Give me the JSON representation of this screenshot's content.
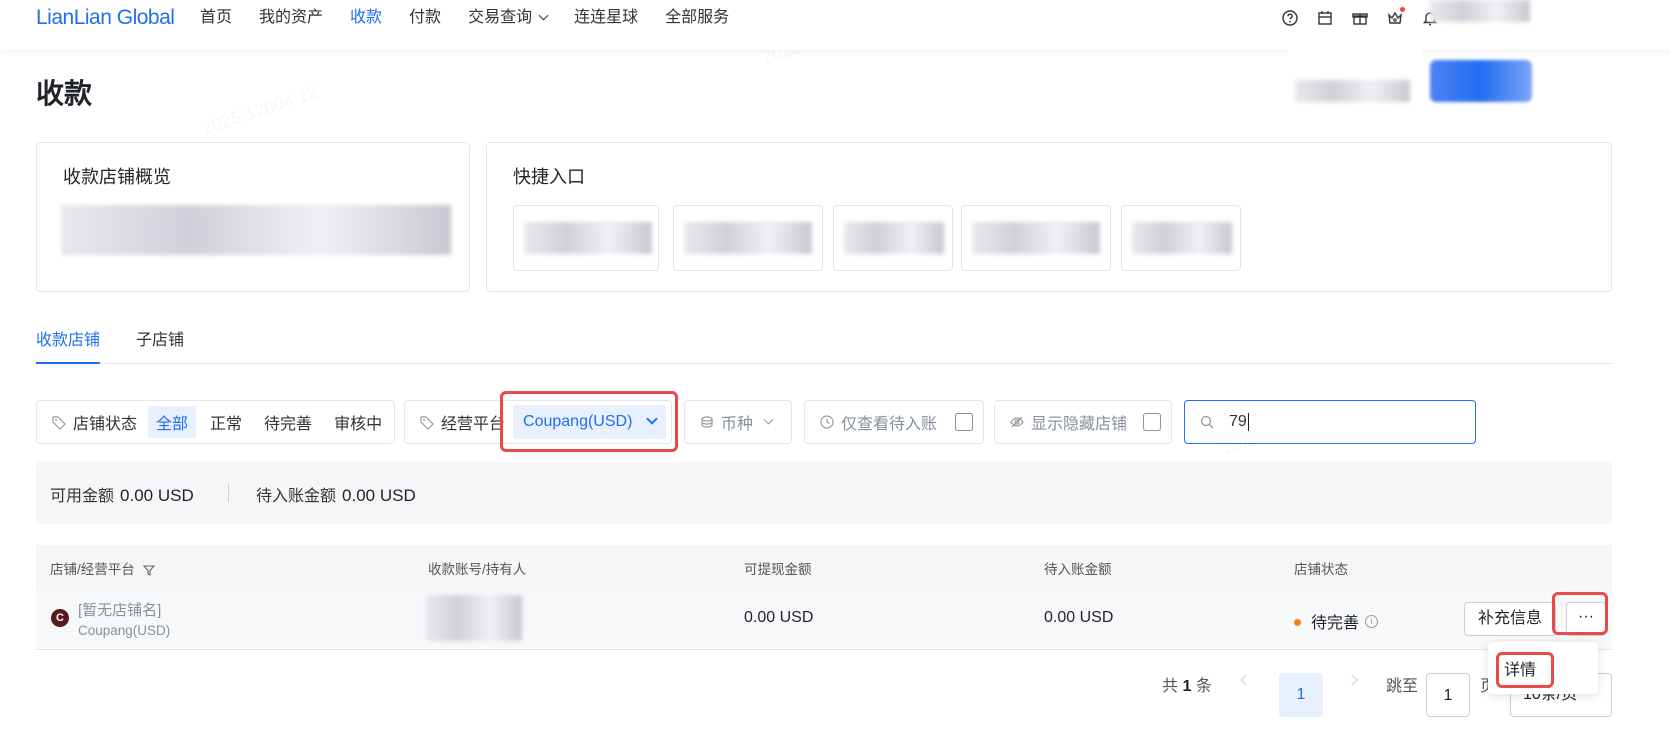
{
  "header": {
    "logo": "LianLian Global",
    "nav": [
      {
        "label": "首页"
      },
      {
        "label": "我的资产"
      },
      {
        "label": "收款",
        "active": true
      },
      {
        "label": "付款"
      },
      {
        "label": "交易查询"
      },
      {
        "label": "连连星球"
      },
      {
        "label": "全部服务"
      }
    ],
    "icons": [
      "help-icon",
      "calendar-icon",
      "gift-icon",
      "crown-icon",
      "bell-icon"
    ]
  },
  "page": {
    "title": "收款"
  },
  "overview_card": {
    "title": "收款店铺概览"
  },
  "quick_card": {
    "title": "快捷入口"
  },
  "tabs": [
    {
      "label": "收款店铺",
      "active": true
    },
    {
      "label": "子店铺"
    }
  ],
  "filters": {
    "status_label": "店铺状态",
    "status_options": [
      "全部",
      "正常",
      "待完善",
      "审核中"
    ],
    "status_selected": "全部",
    "platform_label": "经营平台",
    "platform_value": "Coupang(USD)",
    "currency_label": "币种",
    "pending_only_label": "仅查看待入账",
    "show_hidden_label": "显示隐藏店铺",
    "search_value": "79"
  },
  "summary": {
    "available_label": "可用金额",
    "available_value": "0.00 USD",
    "pending_label": "待入账金额",
    "pending_value": "0.00 USD"
  },
  "table": {
    "headers": [
      "店铺/经营平台",
      "收款账号/持有人",
      "可提现金额",
      "待入账金额",
      "店铺状态"
    ],
    "rows": [
      {
        "avatar": "C",
        "shop_name": "[暂无店铺名]",
        "platform": "Coupang(USD)",
        "withdrawable": "0.00 USD",
        "pending": "0.00 USD",
        "status": "待完善",
        "action_supplement": "补充信息",
        "action_more": "···"
      }
    ]
  },
  "dropdown": {
    "items": [
      "详情"
    ]
  },
  "pagination": {
    "total_prefix": "共",
    "total_count": "1",
    "total_suffix": "条",
    "current_page": "1",
    "jump_label": "跳至",
    "jump_value": "1",
    "page_unit": "页",
    "page_size": "10条/页"
  },
  "colors": {
    "accent": "#1f6ff0",
    "highlight": "#e84a4a",
    "status_pending": "#ff7d00"
  }
}
